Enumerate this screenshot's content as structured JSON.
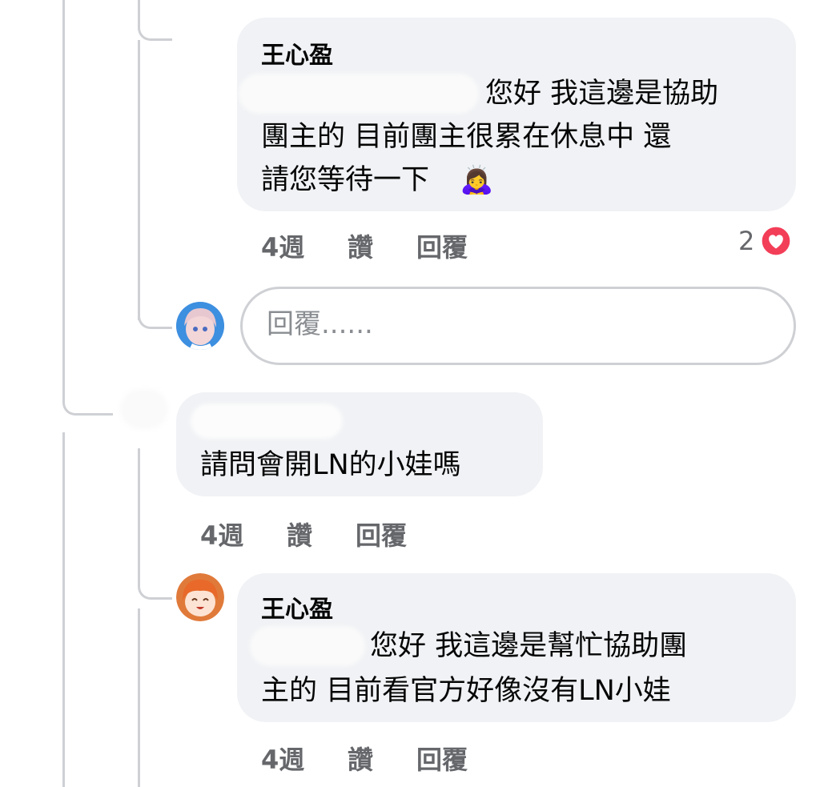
{
  "comments": [
    {
      "author": "王心盈",
      "text_line1": "您好 我這邊是協助",
      "text_line2": "團主的 目前團主很累在休息中 還",
      "text_line3": "請您等待一下",
      "emoji": "🙇‍♀️",
      "time": "4週",
      "like": "讚",
      "reply": "回覆",
      "reaction_count": "2",
      "reaction_icon": "heart-icon"
    },
    {
      "text_line1": "請問會開LN的小娃嗎",
      "time": "4週",
      "like": "讚",
      "reply": "回覆"
    },
    {
      "author": "王心盈",
      "text_line1": "您好 我這邊是幫忙協助團",
      "text_line2": "主的 目前看官方好像沒有LN小娃",
      "time": "4週",
      "like": "讚",
      "reply": "回覆"
    }
  ],
  "reply_input": {
    "placeholder": "回覆......"
  },
  "colors": {
    "bubble": "#f0f2f5",
    "thread_line": "#ced0d4",
    "meta_text": "#65676b",
    "heart": "#f33e58"
  }
}
